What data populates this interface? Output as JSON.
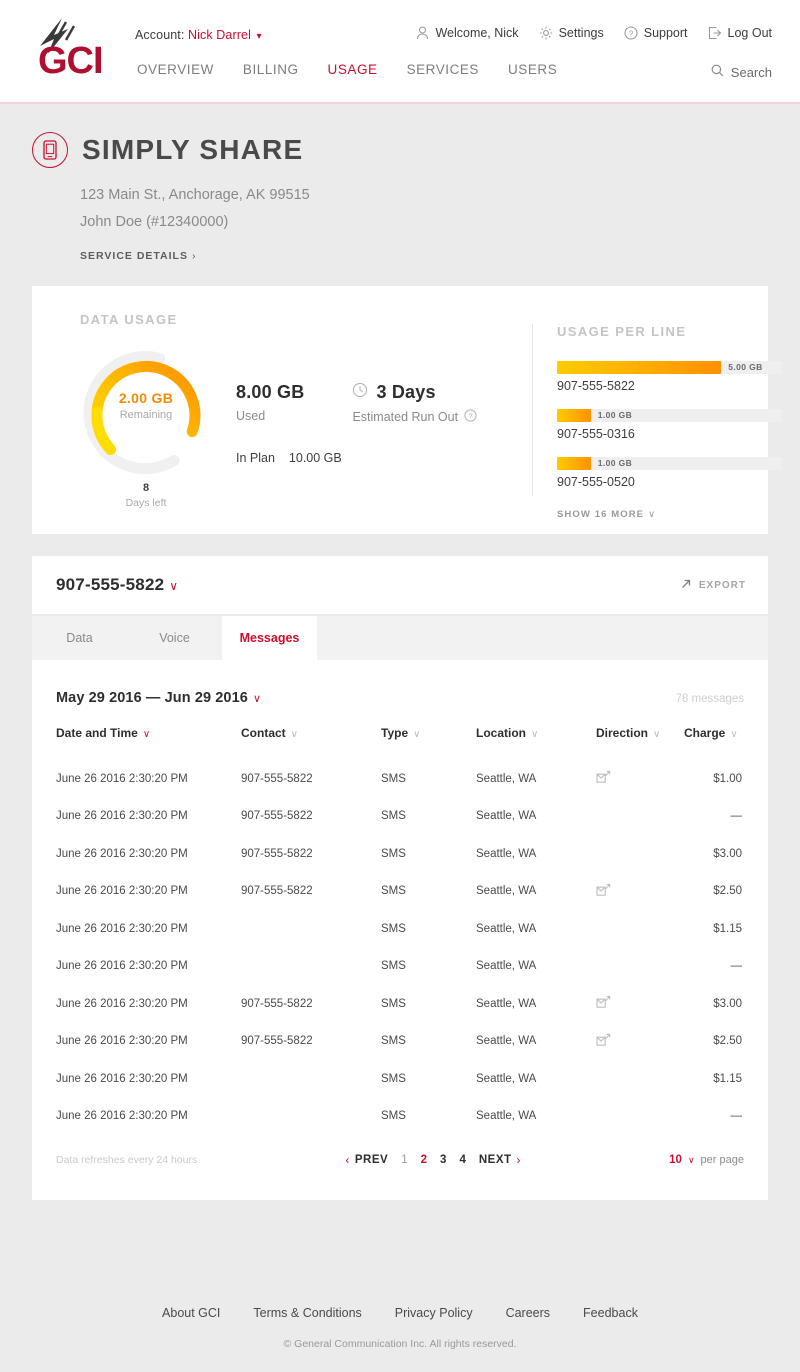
{
  "brand": {
    "logo_text": "GCI",
    "accent": "#c8102e",
    "orange": "#ff9100",
    "yellow": "#ffcc00"
  },
  "header": {
    "account_label": "Account:",
    "account_name": "Nick Darrel",
    "utility": [
      {
        "icon": "user-icon",
        "label": "Welcome, Nick"
      },
      {
        "icon": "gear-icon",
        "label": "Settings"
      },
      {
        "icon": "question-circle-icon",
        "label": "Support"
      },
      {
        "icon": "logout-icon",
        "label": "Log Out"
      }
    ],
    "nav": [
      {
        "label": "OVERVIEW",
        "active": false
      },
      {
        "label": "BILLING",
        "active": false
      },
      {
        "label": "USAGE",
        "active": true
      },
      {
        "label": "SERVICES",
        "active": false
      },
      {
        "label": "USERS",
        "active": false
      }
    ],
    "search_label": "Search"
  },
  "title": {
    "heading": "SIMPLY SHARE",
    "address": "123 Main St., Anchorage, AK 99515",
    "customer": "John Doe (#12340000)",
    "service_details": "SERVICE DETAILS",
    "chevron": "›"
  },
  "data_usage": {
    "section_title": "DATA USAGE",
    "remaining_value": "2.00 GB",
    "remaining_label": "Remaining",
    "days_left_value": "8",
    "days_left_label": "Days left",
    "used_value": "8.00 GB",
    "used_label": "Used",
    "runout_value": "3 Days",
    "runout_label": "Estimated Run Out",
    "in_plan_label": "In Plan",
    "in_plan_value": "10.00 GB"
  },
  "usage_per_line": {
    "section_title": "USAGE PER LINE",
    "lines": [
      {
        "number": "907-555-5822",
        "value": "5.00 GB",
        "pct": 73
      },
      {
        "number": "907-555-0316",
        "value": "1.00 GB",
        "pct": 15
      },
      {
        "number": "907-555-0520",
        "value": "1.00 GB",
        "pct": 15
      }
    ],
    "show_more": "SHOW 16 MORE",
    "chevron": "∨"
  },
  "line_card": {
    "phone": "907-555-5822",
    "chevron": "∨",
    "export_label": "EXPORT"
  },
  "tabs": [
    {
      "label": "Data",
      "active": false
    },
    {
      "label": "Voice",
      "active": false
    },
    {
      "label": "Messages",
      "active": true
    }
  ],
  "table": {
    "date_range": "May 29 2016 — Jun 29 2016",
    "range_chevron": "∨",
    "count": "78 messages",
    "columns": [
      {
        "label": "Date and Time",
        "sorted": true
      },
      {
        "label": "Contact",
        "sorted": false
      },
      {
        "label": "Type",
        "sorted": false
      },
      {
        "label": "Location",
        "sorted": false
      },
      {
        "label": "Direction",
        "sorted": false
      },
      {
        "label": "Charge",
        "sorted": false
      }
    ],
    "column_chevron": "∨",
    "rows": [
      {
        "date": "June 26 2016 2:30:20 PM",
        "contact": "907-555-5822",
        "type": "SMS",
        "location": "Seattle, WA",
        "direction": "outgoing-message-icon",
        "charge": "$1.00"
      },
      {
        "date": "June 26 2016 2:30:20 PM",
        "contact": "907-555-5822",
        "type": "SMS",
        "location": "Seattle, WA",
        "direction": "",
        "charge": "—"
      },
      {
        "date": "June 26 2016 2:30:20 PM",
        "contact": "907-555-5822",
        "type": "SMS",
        "location": "Seattle, WA",
        "direction": "",
        "charge": "$3.00"
      },
      {
        "date": "June 26 2016 2:30:20 PM",
        "contact": "907-555-5822",
        "type": "SMS",
        "location": "Seattle, WA",
        "direction": "outgoing-message-icon",
        "charge": "$2.50"
      },
      {
        "date": "June 26 2016 2:30:20 PM",
        "contact": "",
        "type": "SMS",
        "location": "Seattle, WA",
        "direction": "",
        "charge": "$1.15"
      },
      {
        "date": "June 26 2016 2:30:20 PM",
        "contact": "",
        "type": "SMS",
        "location": "Seattle, WA",
        "direction": "",
        "charge": "—"
      },
      {
        "date": "June 26 2016 2:30:20 PM",
        "contact": "907-555-5822",
        "type": "SMS",
        "location": "Seattle, WA",
        "direction": "outgoing-message-icon",
        "charge": "$3.00"
      },
      {
        "date": "June 26 2016 2:30:20 PM",
        "contact": "907-555-5822",
        "type": "SMS",
        "location": "Seattle, WA",
        "direction": "outgoing-message-icon",
        "charge": "$2.50"
      },
      {
        "date": "June 26 2016 2:30:20 PM",
        "contact": "",
        "type": "SMS",
        "location": "Seattle, WA",
        "direction": "",
        "charge": "$1.15"
      },
      {
        "date": "June 26 2016 2:30:20 PM",
        "contact": "",
        "type": "SMS",
        "location": "Seattle, WA",
        "direction": "",
        "charge": "—"
      }
    ]
  },
  "pager": {
    "note": "Data refreshes every 24 hours",
    "prev": "PREV",
    "prev_arrow": "‹",
    "next": "NEXT",
    "next_arrow": "›",
    "pages": [
      {
        "n": "1",
        "state": "gray"
      },
      {
        "n": "2",
        "state": "on"
      },
      {
        "n": "3",
        "state": "dark"
      },
      {
        "n": "4",
        "state": "dark"
      }
    ],
    "per_page_value": "10",
    "per_page_label": "per page",
    "per_page_chevron": "∨"
  },
  "footer": {
    "links": [
      "About GCI",
      "Terms & Conditions",
      "Privacy Policy",
      "Careers",
      "Feedback"
    ],
    "copyright": "© General Communication Inc. All rights reserved."
  }
}
